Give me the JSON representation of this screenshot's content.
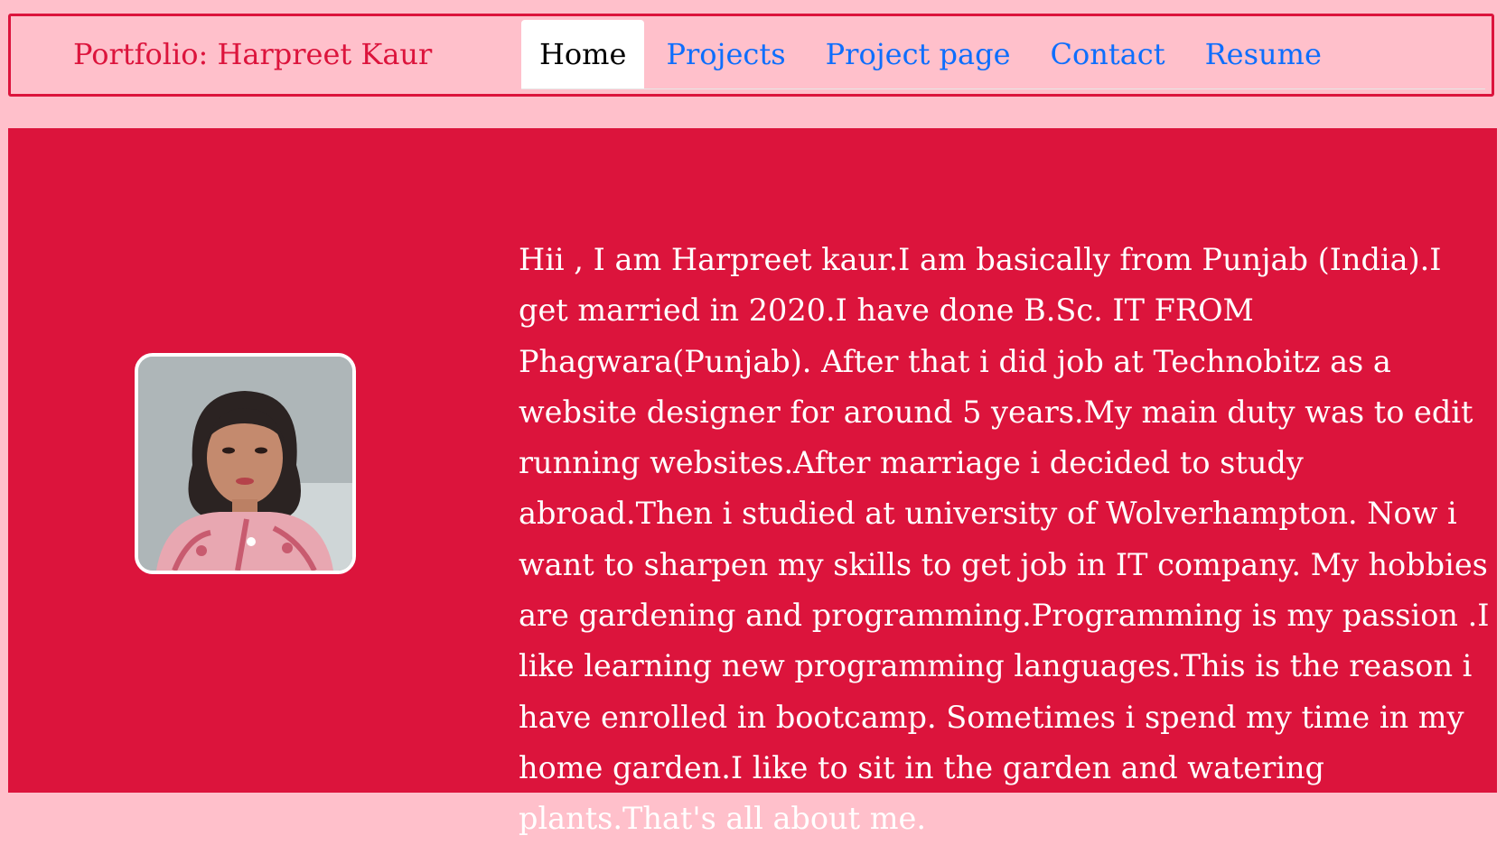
{
  "header": {
    "brand": "Portfolio: Harpreet Kaur",
    "nav": [
      {
        "label": "Home",
        "active": true
      },
      {
        "label": "Projects",
        "active": false
      },
      {
        "label": "Project page",
        "active": false
      },
      {
        "label": "Contact",
        "active": false
      },
      {
        "label": "Resume",
        "active": false
      }
    ]
  },
  "main": {
    "bio": "Hii , I am Harpreet kaur.I am basically from Punjab (India).I get married in 2020.I have done B.Sc. IT FROM Phagwara(Punjab). After that i did job at Technobitz as a website designer for around 5 years.My main duty was to edit running websites.After marriage i decided to study abroad.Then i studied at university of Wolverhampton. Now i want to sharpen my skills to get job in IT company. My hobbies are gardening and programming.Programming is my passion .I like learning new programming languages.This is the reason i have enrolled in bootcamp. Sometimes i spend my time in my home garden.I like to sit in the garden and watering plants.That's all about me."
  },
  "colors": {
    "page_background": "#ffc0cb",
    "accent": "#dc143c",
    "link": "#0d6efd",
    "active_tab_background": "#ffffff",
    "bio_text": "#ffffff"
  }
}
